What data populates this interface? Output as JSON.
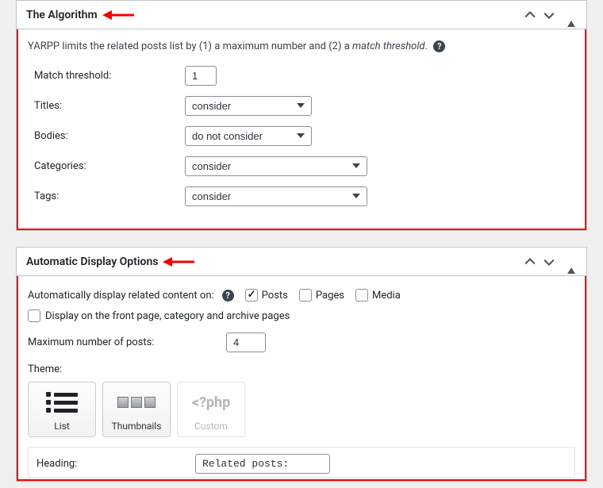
{
  "algorithm": {
    "title": "The Algorithm",
    "lead_prefix": "YARPP limits the related posts list by (1) a maximum number and (2) a ",
    "lead_italic": "match threshold",
    "lead_suffix": ".",
    "match_threshold_label": "Match threshold:",
    "match_threshold_value": "1",
    "titles_label": "Titles:",
    "titles_value": "consider",
    "bodies_label": "Bodies:",
    "bodies_value": "do not consider",
    "categories_label": "Categories:",
    "categories_value": "consider",
    "tags_label": "Tags:",
    "tags_value": "consider"
  },
  "display": {
    "title": "Automatic Display Options",
    "auto_label": "Automatically display related content on:",
    "posts_label": "Posts",
    "pages_label": "Pages",
    "media_label": "Media",
    "posts_checked": true,
    "pages_checked": false,
    "media_checked": false,
    "front_label": "Display on the front page, category and archive pages",
    "front_checked": false,
    "max_label": "Maximum number of posts:",
    "max_value": "4",
    "theme_label": "Theme:",
    "theme_list": "List",
    "theme_thumbs": "Thumbnails",
    "theme_custom": "Custom",
    "theme_custom_icon": "<?php",
    "heading_label": "Heading:",
    "heading_value": "Related posts:"
  },
  "colors": {
    "highlight": "#f60000"
  }
}
